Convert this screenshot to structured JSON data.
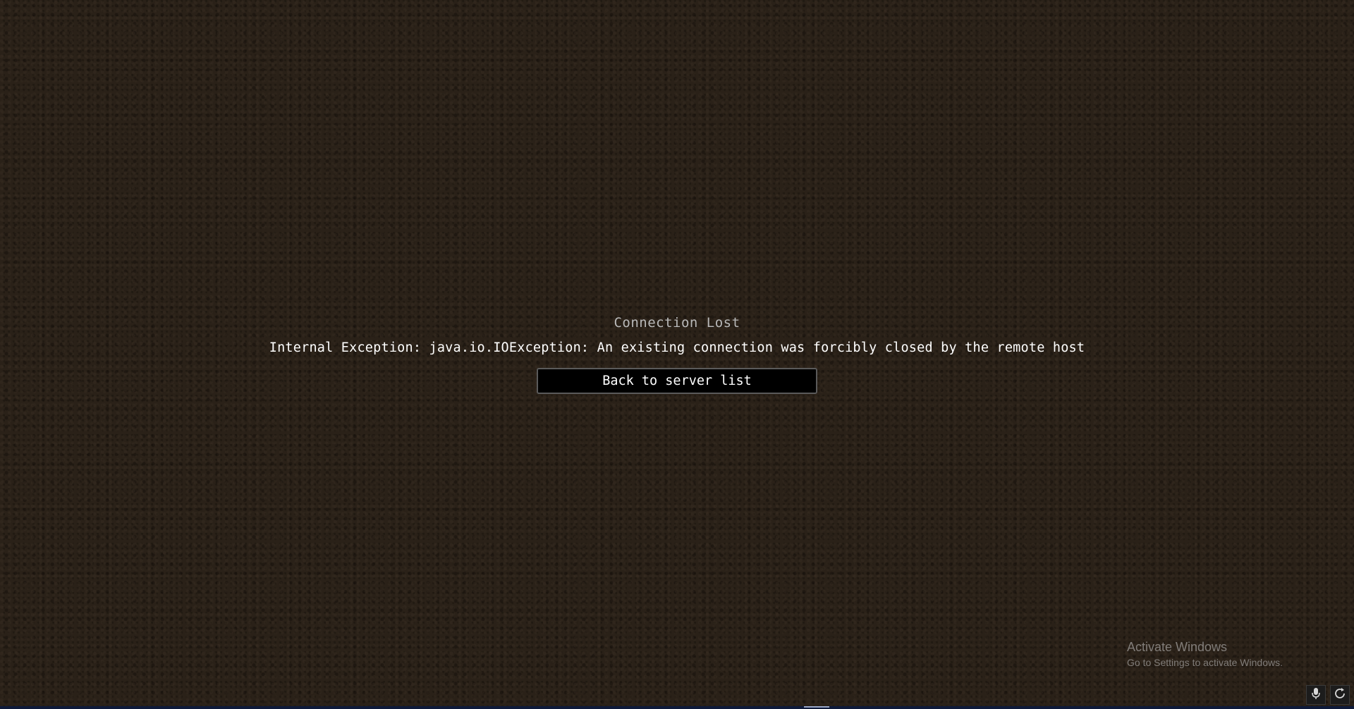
{
  "screen": {
    "title": "Connection Lost",
    "error_message": "Internal Exception: java.io.IOException: An existing connection was forcibly closed by the remote host",
    "back_button_label": "Back to server list"
  },
  "watermark": {
    "title": "Activate Windows",
    "subtitle": "Go to Settings to activate Windows."
  },
  "tray": {
    "icons": [
      "microphone-icon",
      "refresh-icon"
    ]
  },
  "colors": {
    "background": "#2a2118",
    "title_text": "#b9b9b9",
    "message_text": "#ffffff",
    "button_bg": "#000000",
    "button_border": "#5a5a5a"
  }
}
